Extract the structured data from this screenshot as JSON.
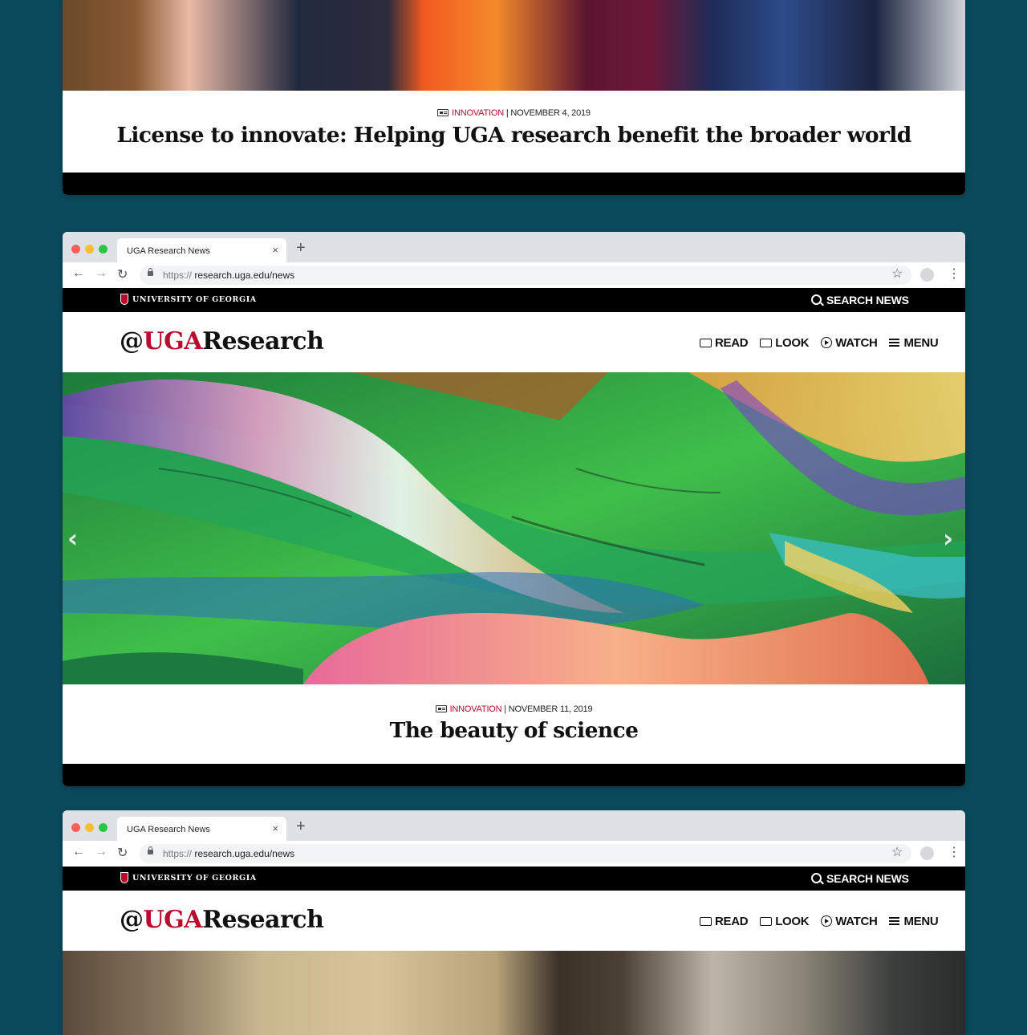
{
  "article1": {
    "category": "INNOVATION",
    "date": "| NOVEMBER 4, 2019",
    "headline": "License to innovate: Helping UGA research benefit the broader world"
  },
  "browser": {
    "tab_title": "UGA Research News",
    "tab_close": "×",
    "new_tab": "+",
    "url_protocol": "https://",
    "url_rest": "research.uga.edu/news",
    "back": "←",
    "forward": "→",
    "reload": "↻",
    "star": "☆",
    "more": "⋮"
  },
  "site": {
    "university": "UNIVERSITY OF GEORGIA",
    "search": "SEARCH NEWS",
    "logo_at": "@",
    "logo_uga": "UGA",
    "logo_research": "Research",
    "nav": {
      "read": "READ",
      "look": "LOOK",
      "watch": "WATCH",
      "menu": "MENU"
    }
  },
  "slider": {
    "prev": "‹",
    "next": "›"
  },
  "article2": {
    "category": "INNOVATION",
    "date": "| NOVEMBER 11, 2019",
    "headline": "The beauty of science"
  },
  "colors": {
    "background": "#0b4a5c",
    "uga_red": "#ba0c2f",
    "black": "#000000"
  }
}
